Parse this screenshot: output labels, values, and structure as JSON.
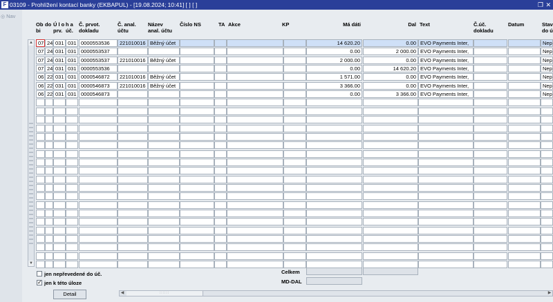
{
  "window": {
    "icon_label": "F",
    "title": "03109 - Prohlížení kontací banky (EKBAPUL) - [19.08.2024; 10:41]  [ ]  [ ]",
    "restore_icon": "restore-icon",
    "close_icon": "close-icon"
  },
  "nav": {
    "label": "Nav"
  },
  "table": {
    "columns": [
      {
        "key": "ob",
        "label": "Ob\nbi"
      },
      {
        "key": "do",
        "label": "do"
      },
      {
        "key": "ulo",
        "label": "Ú l o\nprv."
      },
      {
        "key": "ha",
        "label": "h a\núč."
      },
      {
        "key": "cprvot",
        "label": "Č. prvot.\ndokladu"
      },
      {
        "key": "canal",
        "label": "Č. anal.\núčtu"
      },
      {
        "key": "nazev",
        "label": "Název\nanal. účtu"
      },
      {
        "key": "cislons",
        "label": "Číslo NS"
      },
      {
        "key": "ta",
        "label": "TA"
      },
      {
        "key": "akce",
        "label": "Akce"
      },
      {
        "key": "kp",
        "label": "KP"
      },
      {
        "key": "madati",
        "label": "Má dáti"
      },
      {
        "key": "dal",
        "label": "Dal"
      },
      {
        "key": "text",
        "label": "Text"
      },
      {
        "key": "cuc",
        "label": "Č.úč.\ndokladu"
      },
      {
        "key": "datum",
        "label": "Datum"
      },
      {
        "key": "stav",
        "label": "Stav\ndo ú"
      }
    ],
    "rows": [
      {
        "ob": "07",
        "do": "24",
        "ulo": "031",
        "ha": "031",
        "cprvot": "0000553536",
        "canal": "221010016",
        "nazev": "Běžný účet",
        "cislons": "",
        "ta": "",
        "akce": "",
        "kp": "",
        "madati": "14 620.20",
        "dal": "0.00",
        "text": "EVO Payments Inter,",
        "cuc": "",
        "datum": "",
        "stav": "Nep"
      },
      {
        "ob": "07",
        "do": "24",
        "ulo": "031",
        "ha": "031",
        "cprvot": "0000553537",
        "canal": "",
        "nazev": "",
        "cislons": "",
        "ta": "",
        "akce": "",
        "kp": "",
        "madati": "0.00",
        "dal": "2 000.00",
        "text": "EVO Payments Inter,",
        "cuc": "",
        "datum": "",
        "stav": "Nep"
      },
      {
        "ob": "07",
        "do": "24",
        "ulo": "031",
        "ha": "031",
        "cprvot": "0000553537",
        "canal": "221010016",
        "nazev": "Běžný účet",
        "cislons": "",
        "ta": "",
        "akce": "",
        "kp": "",
        "madati": "2 000.00",
        "dal": "0.00",
        "text": "EVO Payments Inter,",
        "cuc": "",
        "datum": "",
        "stav": "Nep"
      },
      {
        "ob": "07",
        "do": "24",
        "ulo": "031",
        "ha": "031",
        "cprvot": "0000553536",
        "canal": "",
        "nazev": "",
        "cislons": "",
        "ta": "",
        "akce": "",
        "kp": "",
        "madati": "0.00",
        "dal": "14 620.20",
        "text": "EVO Payments Inter,",
        "cuc": "",
        "datum": "",
        "stav": "Nep"
      },
      {
        "ob": "06",
        "do": "22",
        "ulo": "031",
        "ha": "031",
        "cprvot": "0000546872",
        "canal": "221010016",
        "nazev": "Běžný účet",
        "cislons": "",
        "ta": "",
        "akce": "",
        "kp": "",
        "madati": "1 571.00",
        "dal": "0.00",
        "text": "EVO Payments Inter,",
        "cuc": "",
        "datum": "",
        "stav": "Nep"
      },
      {
        "ob": "06",
        "do": "22",
        "ulo": "031",
        "ha": "031",
        "cprvot": "0000546873",
        "canal": "221010016",
        "nazev": "Běžný účet",
        "cislons": "",
        "ta": "",
        "akce": "",
        "kp": "",
        "madati": "3 366.00",
        "dal": "0.00",
        "text": "EVO Payments Inter,",
        "cuc": "",
        "datum": "",
        "stav": "Nep"
      },
      {
        "ob": "06",
        "do": "22",
        "ulo": "031",
        "ha": "031",
        "cprvot": "0000546873",
        "canal": "",
        "nazev": "",
        "cislons": "",
        "ta": "",
        "akce": "",
        "kp": "",
        "madati": "0.00",
        "dal": "3 366.00",
        "text": "EVO Payments Inter,",
        "cuc": "",
        "datum": "",
        "stav": "Nep"
      }
    ]
  },
  "footer": {
    "checkbox_unposted": {
      "label": "jen nepřevedené do úč.",
      "checked": false
    },
    "checkbox_task": {
      "label": "jen k této úloze",
      "checked": true
    },
    "checkmark": "✓",
    "total_label": "Celkem",
    "mddal_label": "MD-DAL",
    "detail_button": "Detail"
  },
  "icons": {
    "vscroll_up": "▲",
    "vscroll_down": "▼",
    "hscroll_left": "◀",
    "hscroll_right": "▶"
  }
}
